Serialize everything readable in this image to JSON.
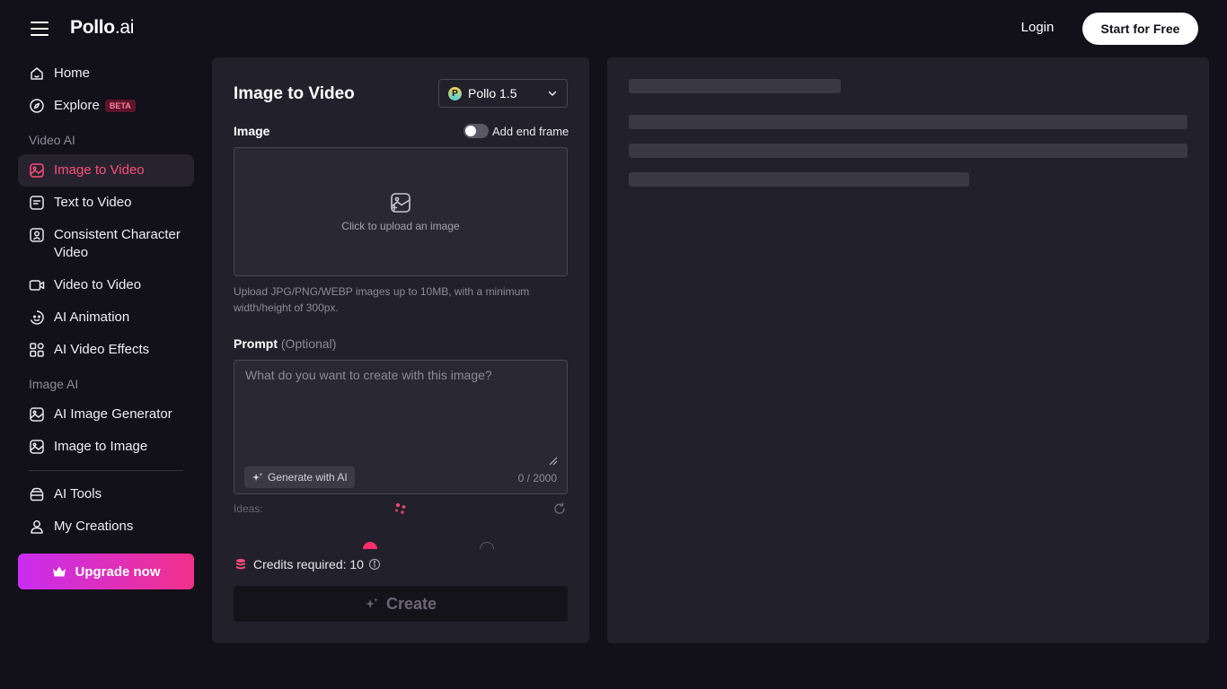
{
  "header": {
    "logo_main": "Pollo",
    "logo_suffix": ".ai",
    "login_label": "Login",
    "start_label": "Start for Free"
  },
  "sidebar": {
    "home": "Home",
    "explore": "Explore",
    "explore_badge": "BETA",
    "section_video": "Video AI",
    "image_to_video": "Image to Video",
    "text_to_video": "Text to Video",
    "consistent_character": "Consistent Character Video",
    "video_to_video": "Video to Video",
    "ai_animation": "AI Animation",
    "ai_video_effects": "AI Video Effects",
    "section_image": "Image AI",
    "ai_image_generator": "AI Image Generator",
    "image_to_image": "Image to Image",
    "ai_tools": "AI Tools",
    "my_creations": "My Creations",
    "upgrade_label": "Upgrade now"
  },
  "form": {
    "title": "Image to Video",
    "model_logo_letter": "P",
    "model_label": "Pollo 1.5",
    "image_label": "Image",
    "end_frame_label": "Add end frame",
    "upload_text": "Click to upload an image",
    "upload_hint": "Upload JPG/PNG/WEBP images up to 10MB, with a minimum width/height of 300px.",
    "prompt_label": "Prompt",
    "prompt_optional": "(Optional)",
    "prompt_placeholder": "What do you want to create with this image?",
    "generate_ai_label": "Generate with AI",
    "char_count": "0 / 2000",
    "ideas_label": "Ideas:",
    "credits_text": "Credits required: 10",
    "create_label": "Create"
  },
  "colors": {
    "accent": "#ff4d79",
    "background": "#121018",
    "panel": "#22202a",
    "upgrade_gradient_start": "#c92ef0",
    "upgrade_gradient_end": "#f0308a"
  }
}
